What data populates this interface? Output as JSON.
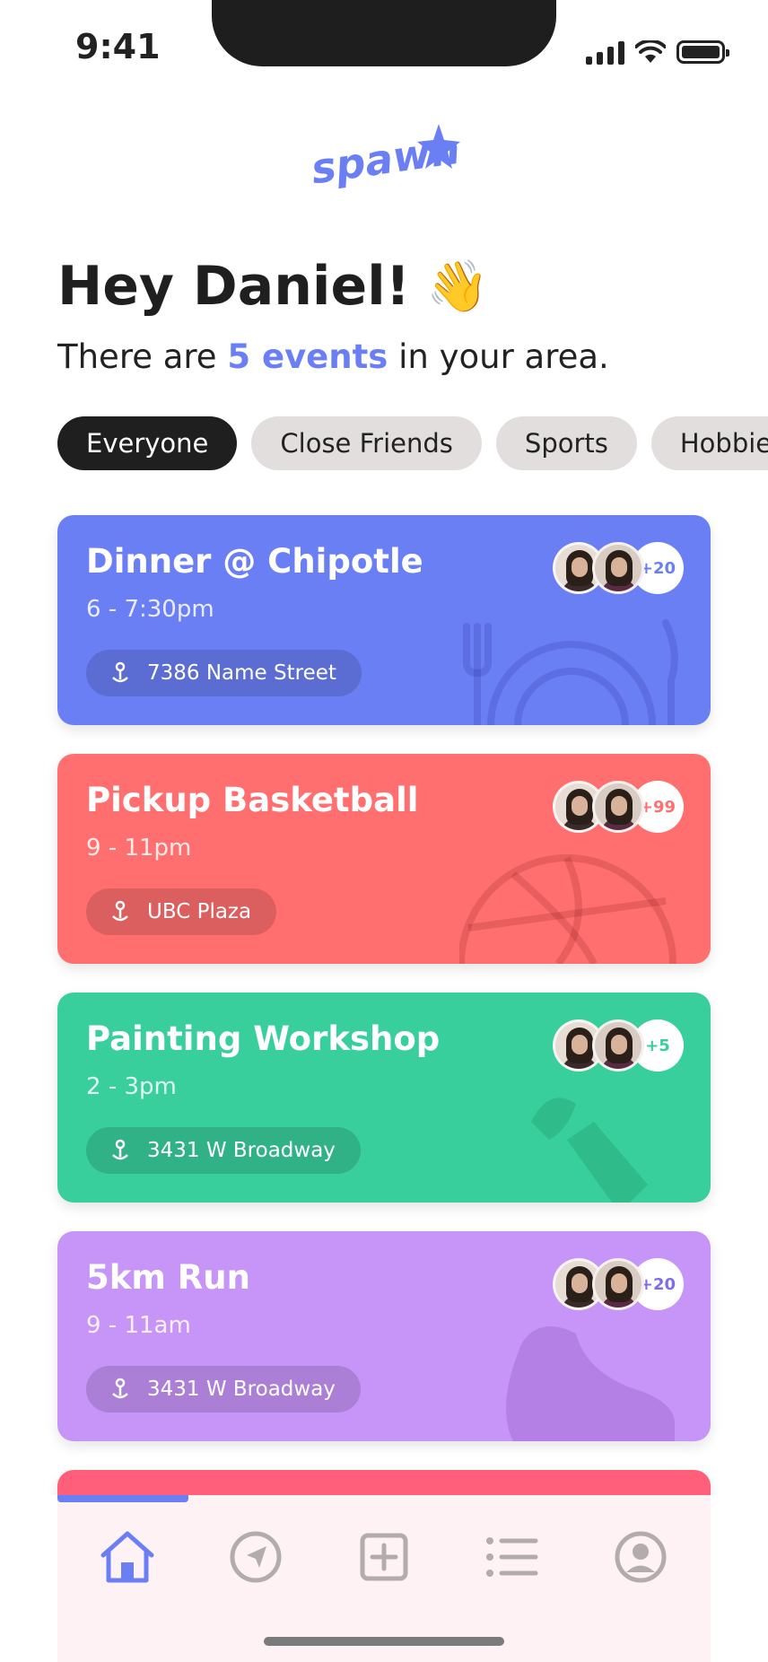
{
  "status_bar": {
    "time": "9:41"
  },
  "brand": {
    "logo_text": "spawn",
    "color": "#6b7ff5"
  },
  "greeting": {
    "title": "Hey Daniel!",
    "emoji": "👋",
    "subtitle_prefix": "There are",
    "subtitle_highlight": "5 events",
    "subtitle_suffix": "in your area."
  },
  "filters": [
    {
      "label": "Everyone",
      "active": true
    },
    {
      "label": "Close Friends",
      "active": false
    },
    {
      "label": "Sports",
      "active": false
    },
    {
      "label": "Hobbies",
      "active": false
    }
  ],
  "events": [
    {
      "title": "Dinner @ Chipotle",
      "time": "6 - 7:30pm",
      "location": "7386 Name Street",
      "attendee_count": "+20",
      "color": "#6b7ff5",
      "icon": "fork-plate-knife-icon"
    },
    {
      "title": "Pickup Basketball",
      "time": "9 - 11pm",
      "location": "UBC Plaza",
      "attendee_count": "+99",
      "color": "#ff6f6f",
      "icon": "basketball-icon"
    },
    {
      "title": "Painting Workshop",
      "time": "2 - 3pm",
      "location": "3431 W Broadway",
      "attendee_count": "+5",
      "color": "#38cf9c",
      "icon": "paintbrush-icon"
    },
    {
      "title": "5km Run",
      "time": "9 - 11am",
      "location": "3431 W Broadway",
      "attendee_count": "+20",
      "color": "#c794f8",
      "icon": "running-shoe-icon"
    },
    {
      "title": "",
      "time": "",
      "location": "",
      "attendee_count": "",
      "color": "#ff5f7a",
      "icon": ""
    }
  ],
  "nav": [
    {
      "name": "home",
      "icon": "home-icon",
      "active": true
    },
    {
      "name": "explore",
      "icon": "compass-icon",
      "active": false
    },
    {
      "name": "create",
      "icon": "plus-square-icon",
      "active": false
    },
    {
      "name": "list",
      "icon": "list-icon",
      "active": false
    },
    {
      "name": "profile",
      "icon": "profile-icon",
      "active": false
    }
  ],
  "colors": {
    "active_nav": "#6b7ff5",
    "inactive_nav": "#b3acac"
  }
}
